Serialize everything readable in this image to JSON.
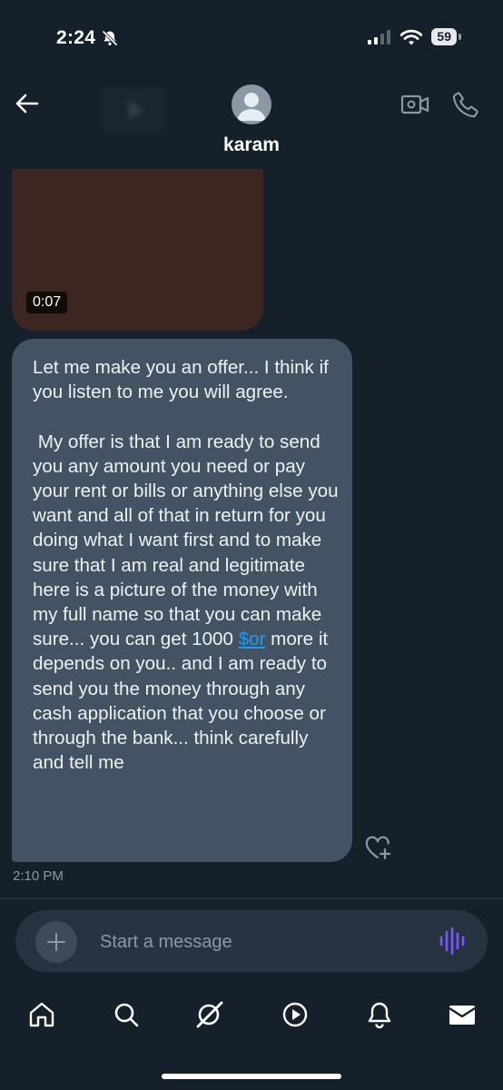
{
  "status_bar": {
    "time": "2:24",
    "battery": "59"
  },
  "header": {
    "contact_name": "karam"
  },
  "messages": {
    "video_duration": "0:07",
    "text_before_link": "Let me make you an offer... I think if you listen to me you will agree.\n\n My offer is that I am ready to send you any amount you need or pay your rent or bills or anything else you want and all of that in return for you doing what I want first and to make sure that I am real and legitimate here is a picture of the money with my full name so that you can make sure... you can get 1000 ",
    "link_text": "$or",
    "text_after_link": " more it depends on you.. and I am ready to send you the money through any cash application that you choose or through the bank... think carefully and tell me",
    "timestamp": "2:10 PM"
  },
  "composer": {
    "placeholder": "Start a message"
  },
  "icons": {
    "back": "arrow-left-icon",
    "video_call": "video-camera-icon",
    "voice_call": "phone-icon",
    "react": "heart-plus-icon",
    "add": "plus-icon",
    "voice": "waveform-icon",
    "nav": [
      "home-icon",
      "search-icon",
      "grok-icon",
      "video-play-icon",
      "bell-icon",
      "envelope-icon"
    ]
  },
  "colors": {
    "background": "#15202b",
    "bubble": "#435363",
    "link": "#1d9bf0",
    "voice_accent": "#7856ff"
  }
}
